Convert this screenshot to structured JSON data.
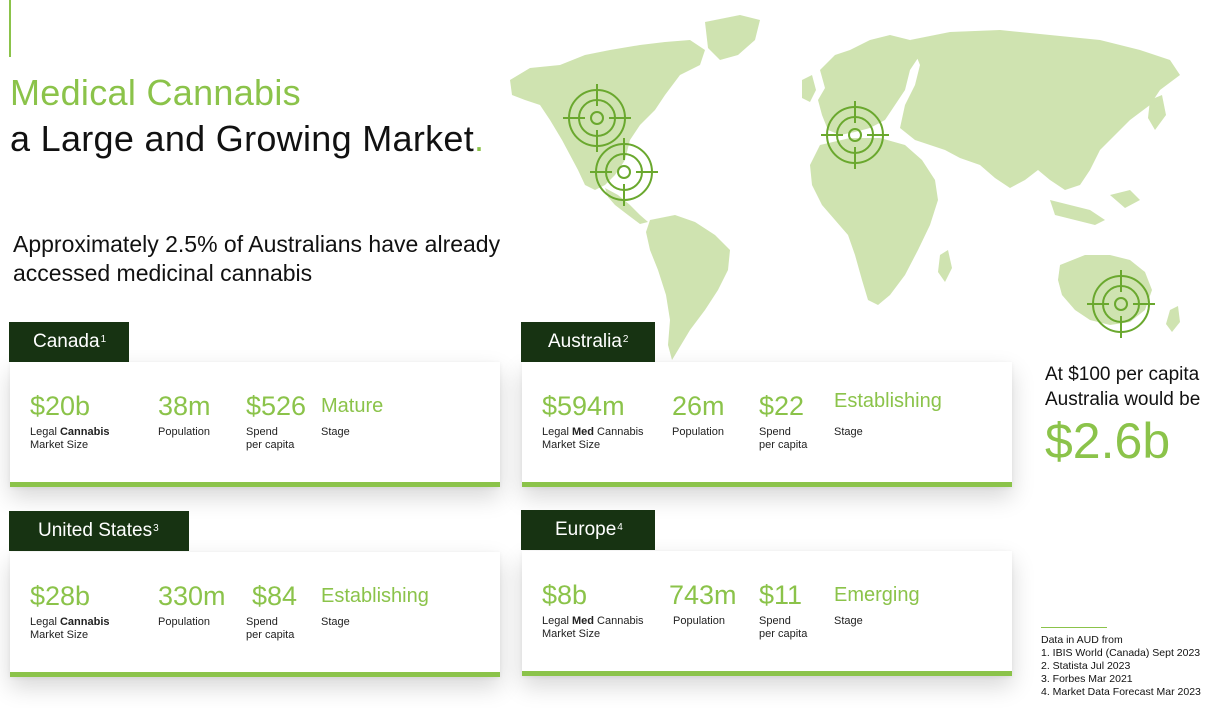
{
  "header": {
    "title_line1": "Medical Cannabis",
    "title_line2": "a Large and Growing Market",
    "title_dot": ".",
    "subtitle": "Approximately 2.5% of Australians have already accessed medicinal cannabis"
  },
  "map": {
    "icon": "world-map",
    "markers": [
      "target-icon",
      "target-icon",
      "target-icon",
      "target-icon"
    ]
  },
  "regions": [
    {
      "name": "Canada",
      "ref": "1",
      "market": {
        "value": "$20b",
        "label_pre": "Legal ",
        "label_bold": "Cannabis",
        "label_post": "",
        "label_line2": "Market Size"
      },
      "population": {
        "value": "38m",
        "label": "Population"
      },
      "spend": {
        "value": "$526",
        "label1": "Spend",
        "label2": "per capita"
      },
      "stage": {
        "value": "Mature",
        "label": "Stage"
      }
    },
    {
      "name": "Australia",
      "ref": "2",
      "market": {
        "value": "$594m",
        "label_pre": "Legal ",
        "label_bold": "Med",
        "label_post": " Cannabis",
        "label_line2": "Market Size"
      },
      "population": {
        "value": "26m",
        "label": "Population"
      },
      "spend": {
        "value": "$22",
        "label1": "Spend",
        "label2": "per capita"
      },
      "stage": {
        "value": "Establishing",
        "label": "Stage"
      }
    },
    {
      "name": "United States",
      "ref": "3",
      "market": {
        "value": "$28b",
        "label_pre": "Legal ",
        "label_bold": "Cannabis",
        "label_post": "",
        "label_line2": "Market Size"
      },
      "population": {
        "value": "330m",
        "label": "Population"
      },
      "spend": {
        "value": "$84",
        "label1": "Spend",
        "label2": "per capita"
      },
      "stage": {
        "value": "Establishing",
        "label": "Stage"
      }
    },
    {
      "name": "Europe",
      "ref": "4",
      "market": {
        "value": "$8b",
        "label_pre": "Legal ",
        "label_bold": "Med",
        "label_post": " Cannabis",
        "label_line2": "Market Size"
      },
      "population": {
        "value": "743m",
        "label": "Population"
      },
      "spend": {
        "value": "$11",
        "label1": "Spend",
        "label2": "per capita"
      },
      "stage": {
        "value": "Emerging",
        "label": "Stage"
      }
    }
  ],
  "callout": {
    "line1": "At $100 per capita",
    "line2": "Australia would be",
    "value": "$2.6b"
  },
  "notes": {
    "heading": "Data in AUD from",
    "sources": [
      "1. IBIS World (Canada)  Sept 2023",
      "2. Statista Jul 2023",
      "3. Forbes Mar 2021",
      "4. Market Data Forecast Mar 2023"
    ]
  },
  "colors": {
    "accent": "#8bc34a",
    "tab_bg": "#173312",
    "map": "#cfe3b0",
    "target": "#6aa82e"
  }
}
